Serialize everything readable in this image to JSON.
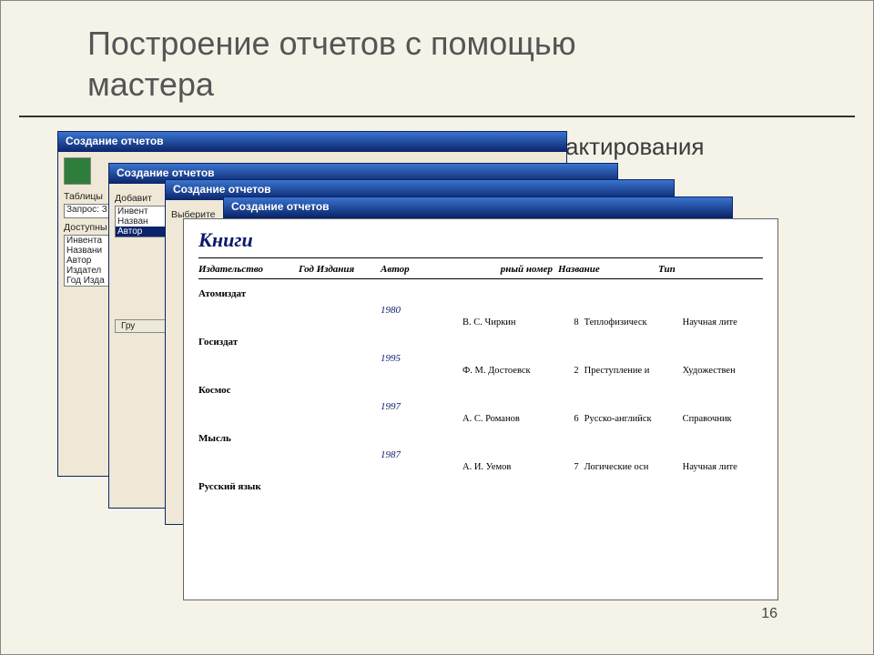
{
  "title_line1": "Построение отчетов с помощью",
  "title_line2": "мастера",
  "bullet_text_partial": "актирования",
  "page_number": "16",
  "dlg_title": "Создание отчетов",
  "wizard1": {
    "label_tables": "Таблицы",
    "select_value": "Запрос: З",
    "label_available": "Доступны",
    "fields": [
      "Инвента",
      "Названи",
      "Автор",
      "Издател",
      "Год Изда"
    ]
  },
  "wizard2": {
    "label_add": "Добавит",
    "fields": [
      "Инвент",
      "Назван",
      "Автор"
    ],
    "btn_group": "Гру"
  },
  "wizard3": {
    "label_choose": "Выберите"
  },
  "report": {
    "title": "Книги",
    "columns": {
      "publisher": "Издательство",
      "year": "Год Издания",
      "author": "Автор",
      "num": "рный номер",
      "name": "Название",
      "type": "Тип"
    },
    "groups": [
      {
        "publisher": "Атомиздат",
        "year": "1980",
        "author": "В. С. Чиркин",
        "num": "8",
        "name": "Теплофизическ",
        "type": "Научная лите"
      },
      {
        "publisher": "Госиздат",
        "year": "1995",
        "author": "Ф. М. Достоевск",
        "num": "2",
        "name": "Преступление и",
        "type": "Художествен"
      },
      {
        "publisher": "Космос",
        "year": "1997",
        "author": "А. С. Романов",
        "num": "6",
        "name": "Русско-английск",
        "type": "Справочник"
      },
      {
        "publisher": "Мысль",
        "year": "1987",
        "author": "А. И. Уемов",
        "num": "7",
        "name": "Логические осн",
        "type": "Научная лите"
      }
    ],
    "last_publisher": "Русский язык"
  }
}
